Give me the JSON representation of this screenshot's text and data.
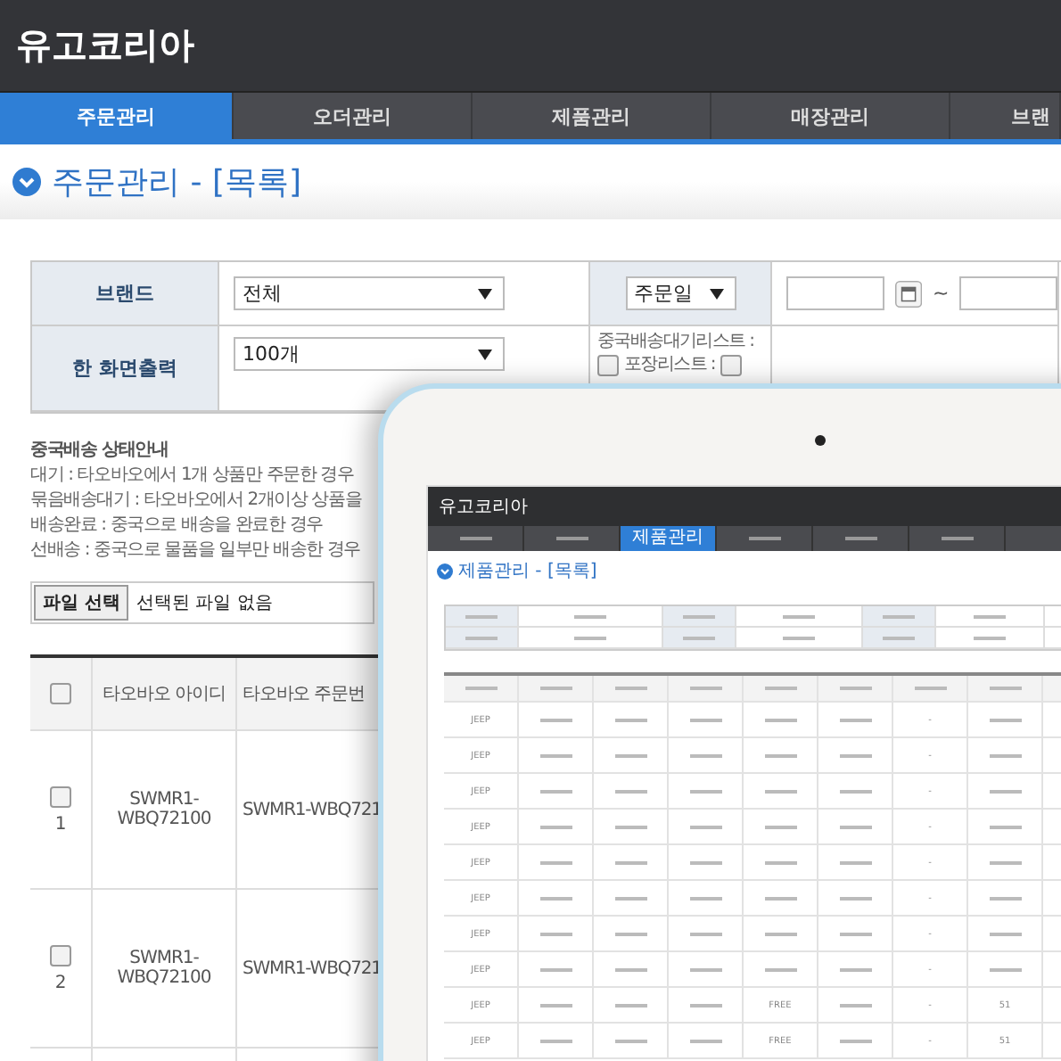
{
  "header": {
    "title": "유고코리아"
  },
  "nav_tabs": [
    {
      "label": "주문관리",
      "selected": true
    },
    {
      "label": "오더관리",
      "selected": false
    },
    {
      "label": "제품관리",
      "selected": false
    },
    {
      "label": "매장관리",
      "selected": false
    },
    {
      "label": "브랜",
      "selected": false
    }
  ],
  "page_title": "주문관리 - [목록]",
  "filters": {
    "brand_label": "브랜드",
    "brand_value": "전체",
    "date_type": "주문일",
    "date_separator": "~",
    "per_page_label": "한 화면출력",
    "per_page_value": "100개",
    "wait_list_label": "중국배송대기리스트 :",
    "wait_list_checked": false,
    "packing_list_label": "포장리스트 :",
    "packing_list_checked": false
  },
  "shipping_guide": {
    "title": "중국배송 상태안내",
    "lines": [
      "대기 : 타오바오에서 1개 상품만 주문한 경우",
      "묶음배송대기 : 타오바오에서 2개이상 상품을",
      "배송완료 : 중국으로 배송을 완료한 경우",
      "선배송 : 중국으로 물품을 일부만 배송한 경우"
    ]
  },
  "file_upload": {
    "button": "파일 선택",
    "status": "선택된 파일 없음"
  },
  "orders_table": {
    "all_checked": false,
    "columns": [
      "타오바오 아이디",
      "타오바오 주문번"
    ],
    "rows": [
      {
        "number": "1",
        "checked": false,
        "taobao_id": "SWMR1-WBQ72100",
        "order_no": "SWMR1-WBQ721"
      },
      {
        "number": "2",
        "checked": false,
        "taobao_id": "SWMR1-WBQ72100",
        "order_no": "SWMR1-WBQ721"
      }
    ]
  },
  "tablet": {
    "title": "유고코리아",
    "tabs": [
      {
        "selected": false
      },
      {
        "selected": false
      },
      {
        "label": "제품관리",
        "selected": true
      },
      {
        "selected": false
      },
      {
        "selected": false
      },
      {
        "selected": false
      }
    ],
    "page_title": "제품관리 - [목록]",
    "rows": [
      {
        "brand": "JEEP",
        "option": "-"
      },
      {
        "brand": "JEEP",
        "option": "-"
      },
      {
        "brand": "JEEP",
        "option": "-"
      },
      {
        "brand": "JEEP",
        "option": "-"
      },
      {
        "brand": "JEEP",
        "option": "-"
      },
      {
        "brand": "JEEP",
        "option": "-"
      },
      {
        "brand": "JEEP",
        "option": "-"
      },
      {
        "brand": "JEEP",
        "option": "-"
      },
      {
        "brand": "JEEP",
        "option": "-",
        "size": "FREE",
        "qty": "51"
      },
      {
        "brand": "JEEP",
        "option": "-",
        "size": "FREE",
        "qty": "51"
      }
    ]
  }
}
